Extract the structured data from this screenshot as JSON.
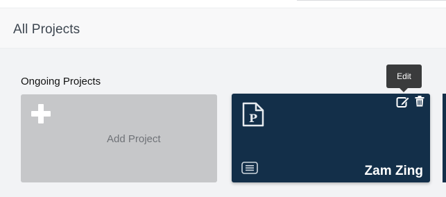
{
  "header": {
    "title": "All Projects"
  },
  "section": {
    "title": "Ongoing Projects"
  },
  "add_card": {
    "label": "Add Project",
    "icon": "plus-icon"
  },
  "project_card": {
    "name": "Zam Zing",
    "icons": [
      "p-document-icon",
      "list-icon",
      "edit-icon",
      "trash-icon"
    ],
    "background": "#132f49"
  },
  "tooltip": {
    "text": "Edit"
  }
}
